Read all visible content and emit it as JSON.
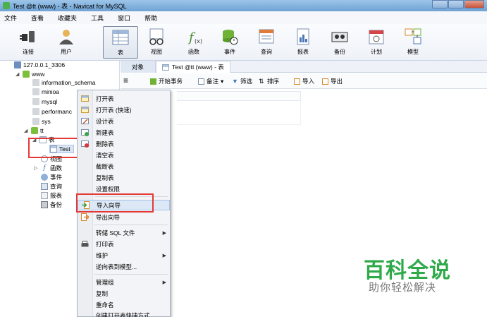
{
  "window": {
    "title": "Test @tt (www) - 表 - Navicat for MySQL"
  },
  "menubar": [
    "文件",
    "查看",
    "收藏夹",
    "工具",
    "窗口",
    "帮助"
  ],
  "toolbar": [
    {
      "label": "连接",
      "icon": "plug-icon"
    },
    {
      "label": "用户",
      "icon": "user-icon"
    },
    {
      "label": "表",
      "icon": "table-icon"
    },
    {
      "label": "视图",
      "icon": "view-icon"
    },
    {
      "label": "函数",
      "icon": "function-icon"
    },
    {
      "label": "事件",
      "icon": "event-icon"
    },
    {
      "label": "查询",
      "icon": "query-icon"
    },
    {
      "label": "报表",
      "icon": "report-icon"
    },
    {
      "label": "备份",
      "icon": "backup-icon"
    },
    {
      "label": "计划",
      "icon": "schedule-icon"
    },
    {
      "label": "模型",
      "icon": "model-icon"
    }
  ],
  "tree": {
    "connection": "127.0.0.1_3306",
    "group": "www",
    "databases": [
      "information_schema",
      "minioa",
      "mysql",
      "performanc",
      "sys"
    ],
    "active_db": "tt",
    "node_table": "表",
    "table_item": "Test",
    "nodes": [
      "视图",
      "函数",
      "事件",
      "查询",
      "报表",
      "备份"
    ]
  },
  "tabs": {
    "objects": "对象",
    "current": "Test @tt (www) - 表"
  },
  "objbar": {
    "begin_tx": "开始事务",
    "memo": "备注",
    "filter": "筛选",
    "sort": "排序",
    "import": "导入",
    "export": "导出"
  },
  "context_menu": [
    {
      "label": "打开表",
      "icon": "open-table-icon"
    },
    {
      "label": "打开表 (快速)",
      "icon": "open-fast-icon"
    },
    {
      "label": "设计表",
      "icon": "design-icon"
    },
    {
      "label": "新建表",
      "icon": "new-table-icon"
    },
    {
      "label": "删除表",
      "icon": "delete-icon"
    },
    {
      "label": "清空表",
      "icon": ""
    },
    {
      "label": "截断表",
      "icon": ""
    },
    {
      "label": "复制表",
      "icon": ""
    },
    {
      "label": "设置权限",
      "icon": ""
    },
    {
      "label": "导入向导",
      "icon": "import-wizard-icon"
    },
    {
      "label": "导出向导",
      "icon": "export-wizard-icon"
    },
    {
      "label": "转储 SQL 文件",
      "icon": "",
      "submenu": true
    },
    {
      "label": "打印表",
      "icon": "print-icon"
    },
    {
      "label": "维护",
      "icon": "",
      "submenu": true
    },
    {
      "label": "逆向表到模型...",
      "icon": ""
    },
    {
      "label": "管理组",
      "icon": "",
      "submenu": true
    },
    {
      "label": "复制",
      "icon": ""
    },
    {
      "label": "重命名",
      "icon": ""
    },
    {
      "label": "创建打开表快捷方式",
      "icon": ""
    }
  ],
  "watermark": {
    "big": "百科全说",
    "small": "助你轻松解决"
  },
  "colors": {
    "highlight_box": "#e53935",
    "watermark_green": "#2eaa4a"
  }
}
